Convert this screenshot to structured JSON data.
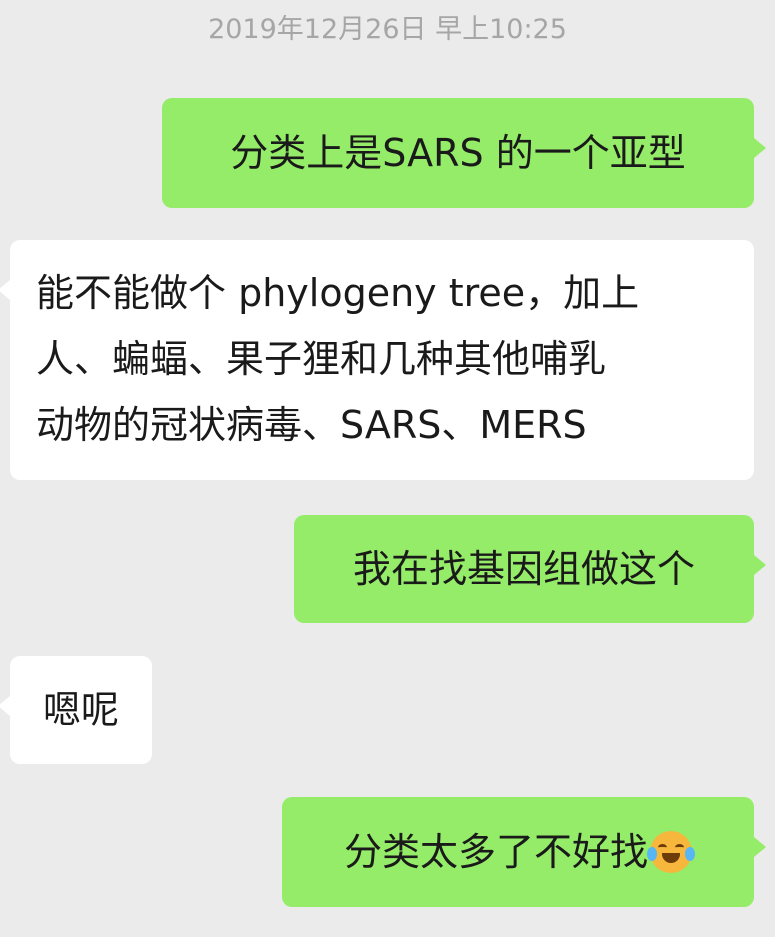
{
  "chat": {
    "timestamp": "2019年12月26日 早上10:25",
    "messages": [
      {
        "side": "out",
        "text": "分类上是SARS 的一个亚型"
      },
      {
        "side": "in",
        "lines": [
          "能不能做个 phylogeny tree，加上",
          "人、蝙蝠、果子狸和几种其他哺乳",
          "动物的冠状病毒、SARS、MERS"
        ]
      },
      {
        "side": "out",
        "text": "我在找基因组做这个"
      },
      {
        "side": "in",
        "text": "嗯呢"
      },
      {
        "side": "out",
        "text": "分类太多了不好找",
        "emoji": "laughing-tears-emoji"
      }
    ]
  }
}
